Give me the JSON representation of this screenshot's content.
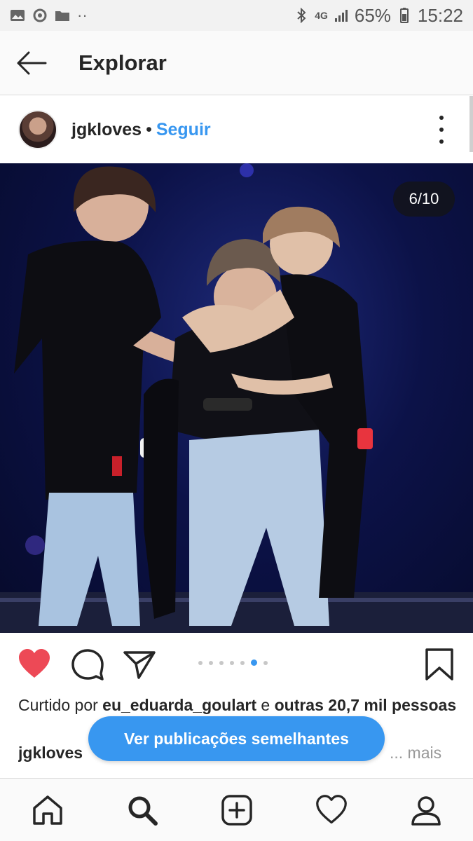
{
  "status_bar": {
    "network": "4G",
    "battery": "65%",
    "time": "15:22"
  },
  "header": {
    "title": "Explorar"
  },
  "post": {
    "username": "jgkloves",
    "separator": "•",
    "follow_label": "Seguir",
    "carousel_counter": "6/10",
    "carousel_total": 10,
    "carousel_active_index": 6
  },
  "likes": {
    "prefix": "Curtido por",
    "user": "eu_eduarda_goulart",
    "conjunction": "e",
    "others": "outras 20,7 mil pessoas"
  },
  "caption": {
    "username": "jgkloves",
    "more_label": "... mais"
  },
  "similar_button": {
    "label": "Ver publicações semelhantes"
  },
  "colors": {
    "accent": "#3897f0",
    "like": "#ed4956",
    "text": "#262626"
  },
  "icons": {
    "back": "arrow-left-icon",
    "more": "more-vertical-icon",
    "like": "heart-filled-icon",
    "comment": "comment-icon",
    "share": "send-icon",
    "save": "bookmark-icon",
    "home": "home-icon",
    "search": "search-icon",
    "add": "add-post-icon",
    "activity": "heart-outline-icon",
    "profile": "profile-icon"
  }
}
